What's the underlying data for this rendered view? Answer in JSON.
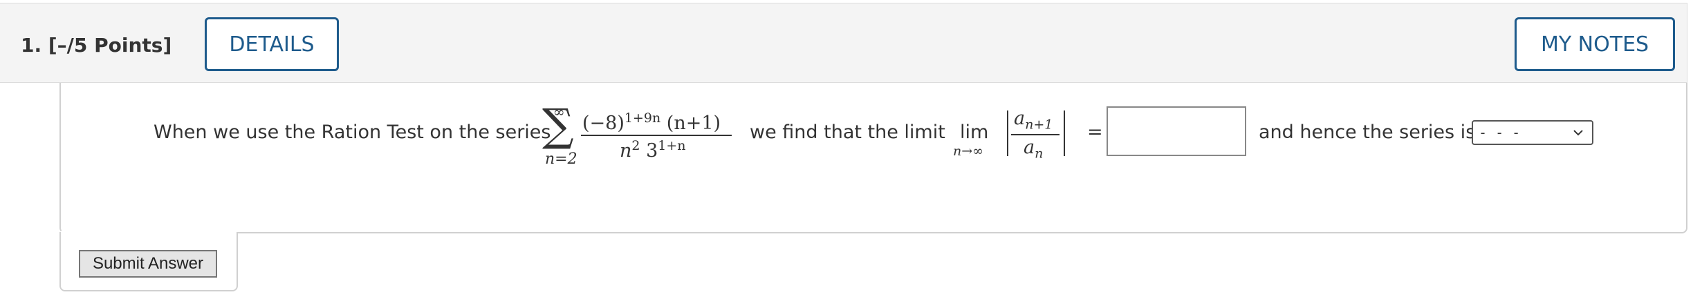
{
  "header": {
    "question_label": "1.  [–/5 Points]",
    "details_label": "DETAILS",
    "notes_label": "MY NOTES"
  },
  "question": {
    "text_before_series": "When we use the Ration Test on the series",
    "text_after_series": "we find that the limit",
    "text_after_input": "and hence the series is",
    "sum_symbol": "∑",
    "sum_upper": "∞",
    "sum_lower": "n=2",
    "numerator_base": "(−8)",
    "numerator_exp": "1+9n",
    "numerator_tail": " (n+1)",
    "denominator_n": "n",
    "denominator_n_exp": "2",
    "denominator_base": " 3",
    "denominator_exp": "1+n",
    "lim_word": "lim",
    "lim_sub": "n→∞",
    "ratio_num_base": "a",
    "ratio_num_sub": "n+1",
    "ratio_den_base": "a",
    "ratio_den_sub": "n",
    "equals": "="
  },
  "answer_input": {
    "value": "",
    "placeholder": ""
  },
  "series_select": {
    "selected": "- - -"
  },
  "submit": {
    "label": "Submit Answer"
  },
  "colors": {
    "accent": "#1e5b8c",
    "header_bg": "#f4f4f4",
    "text": "#333333"
  }
}
